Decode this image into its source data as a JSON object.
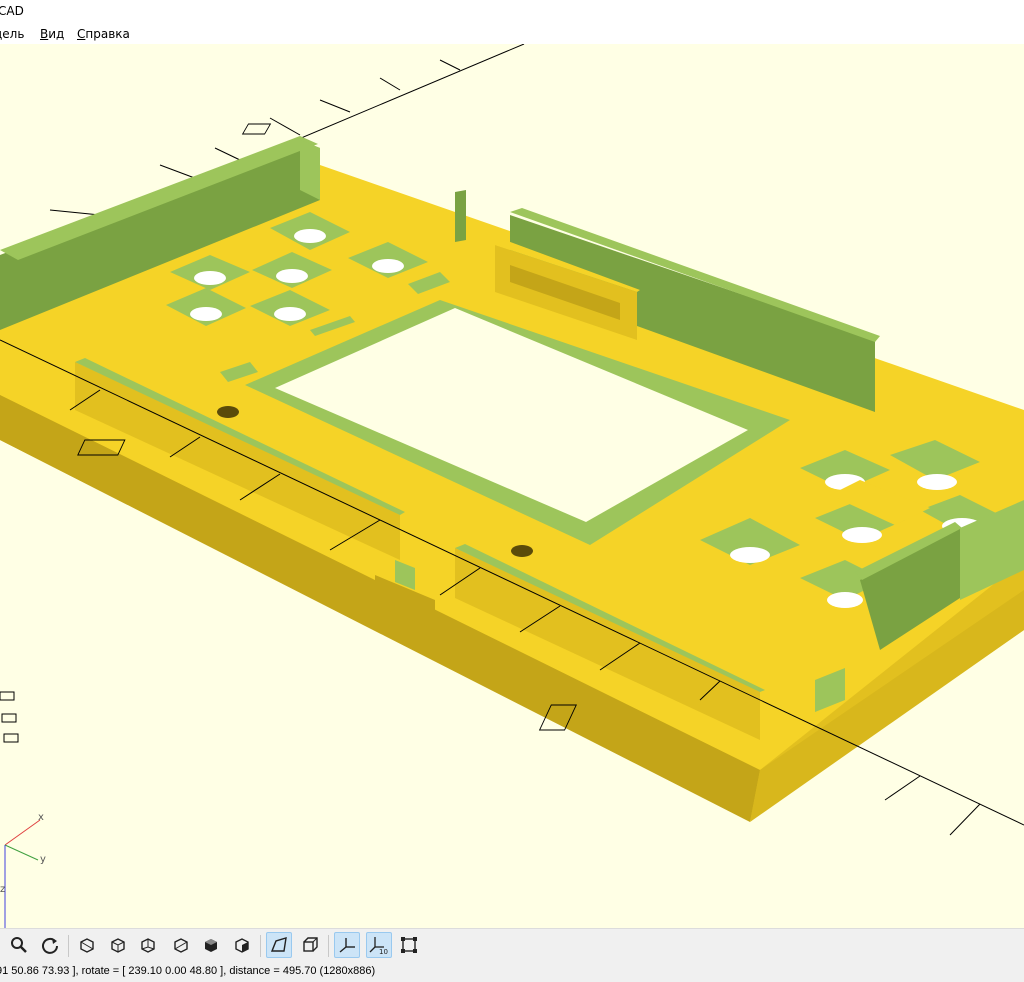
{
  "window": {
    "title": "CAD"
  },
  "menu": {
    "items": [
      {
        "pre": "",
        "accel": "",
        "rest": "дель"
      },
      {
        "pre": "",
        "accel": "В",
        "rest": "ид"
      },
      {
        "pre": "",
        "accel": "С",
        "rest": "правка"
      }
    ]
  },
  "viewport": {
    "background": "#ffffe5",
    "model_top_color": "#f5d327",
    "model_side_color": "#e2c01f",
    "model_dark_side_color": "#c4a518",
    "model_green_color": "#9dc55b",
    "model_green_dark": "#7aa242",
    "axis_line_color": "#000000",
    "axis_labels": {
      "x": "x",
      "y": "y",
      "z": "z"
    }
  },
  "toolbar": {
    "buttons": [
      {
        "name": "zoom-icon",
        "active": false
      },
      {
        "name": "reset-view-icon",
        "active": false
      },
      {
        "name": "view-right-icon",
        "active": false
      },
      {
        "name": "view-top-icon",
        "active": false
      },
      {
        "name": "view-bottom-icon",
        "active": false
      },
      {
        "name": "view-left-icon",
        "active": false
      },
      {
        "name": "view-front-icon",
        "active": false
      },
      {
        "name": "view-back-icon",
        "active": false
      },
      {
        "name": "perspective-icon",
        "active": true
      },
      {
        "name": "orthogonal-icon",
        "active": false
      },
      {
        "name": "show-axes-icon",
        "active": true
      },
      {
        "name": "show-scale-markers-icon",
        "active": true
      },
      {
        "name": "show-edges-icon",
        "active": false
      }
    ]
  },
  "status": {
    "text": "91 50.86 73.93 ], rotate = [ 239.10 0.00 48.80 ], distance = 495.70 (1280x886)"
  }
}
